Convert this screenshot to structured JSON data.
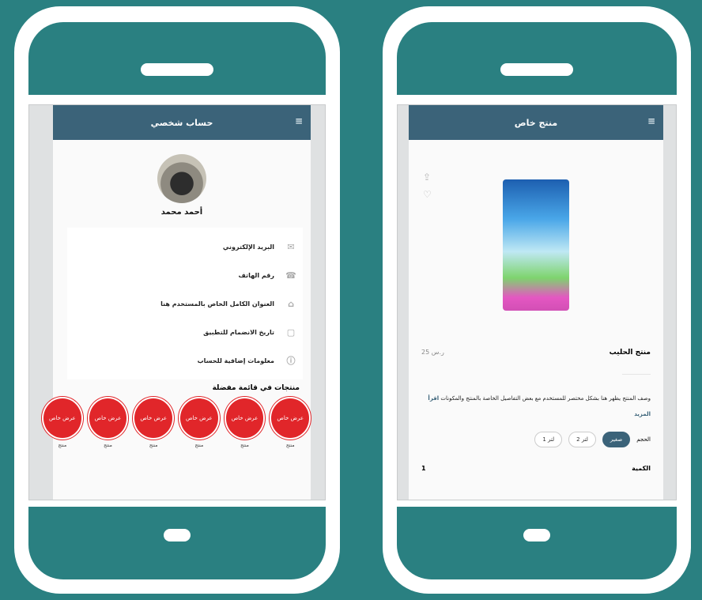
{
  "left_phone": {
    "header_title": "حساب شخصي",
    "menu_icon": "menu-icon",
    "user_name": "أحمد محمد",
    "info_rows": [
      {
        "icon": "mail-icon",
        "text": "البريد الإلكتروني"
      },
      {
        "icon": "phone-icon",
        "text": "رقم الهاتف"
      },
      {
        "icon": "location-icon",
        "text": "العنوان الكامل الخاص بالمستخدم هنا"
      },
      {
        "icon": "calendar-icon",
        "text": "تاريخ الانضمام للتطبيق"
      },
      {
        "icon": "info-icon",
        "text": "معلومات إضافية للحساب"
      }
    ],
    "section_title": "منتجات في قائمة مفضلة",
    "circles": [
      {
        "label": "عرض خاص",
        "caption": "منتج"
      },
      {
        "label": "عرض خاص",
        "caption": "منتج"
      },
      {
        "label": "عرض خاص",
        "caption": "منتج"
      },
      {
        "label": "عرض خاص",
        "caption": "منتج"
      },
      {
        "label": "عرض خاص",
        "caption": "منتج"
      },
      {
        "label": "عرض خاص",
        "caption": "منتج"
      }
    ]
  },
  "right_phone": {
    "header_title": "منتج خاص",
    "menu_icon": "menu-icon",
    "side_icons": [
      "share-icon",
      "heart-icon"
    ],
    "product_name": "منتج الحليب",
    "price": "25 ر.س",
    "description": "وصف المنتج يظهر هنا بشكل مختصر للمستخدم مع بعض التفاصيل الخاصة بالمنتج والمكونات",
    "link": "اقرأ المزيد",
    "chips": [
      {
        "label": "1 لتر",
        "active": false
      },
      {
        "label": "2 لتر",
        "active": false
      },
      {
        "label": "صغير",
        "active": true
      }
    ],
    "size_label": "الحجم",
    "bottom_left": "1",
    "bottom_right": "الكمية"
  },
  "colors": {
    "background": "#2a8081",
    "appbar": "#3b6379",
    "accent_red": "#e1262a"
  }
}
